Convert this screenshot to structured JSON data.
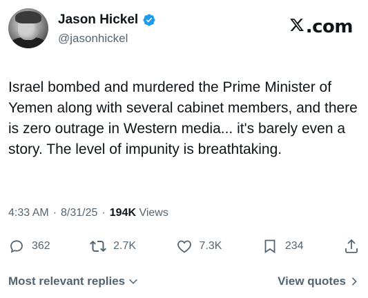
{
  "author": {
    "name": "Jason Hickel",
    "handle": "@jasonhickel",
    "verified_color": "#1d9bf0"
  },
  "brand": {
    "label": ".com",
    "icon": "x-logo-icon"
  },
  "tweet": {
    "text": "Israel bombed and murdered the Prime Minister of Yemen along with several cabinet members, and there is zero outrage in Western media... it's barely even a story. The level of impunity is breathtaking."
  },
  "meta": {
    "time": "4:33 AM",
    "sep1": "·",
    "date": "8/31/25",
    "sep2": "·",
    "views_count": "194K",
    "views_label": "Views"
  },
  "actions": {
    "replies": {
      "icon": "reply-icon",
      "count": "362"
    },
    "reposts": {
      "icon": "repost-icon",
      "count": "2.7K"
    },
    "likes": {
      "icon": "heart-icon",
      "count": "7.3K"
    },
    "bookmarks": {
      "icon": "bookmark-icon",
      "count": "234"
    },
    "share": {
      "icon": "share-icon"
    }
  },
  "footer": {
    "replies_sort": "Most relevant replies",
    "view_quotes": "View quotes"
  }
}
